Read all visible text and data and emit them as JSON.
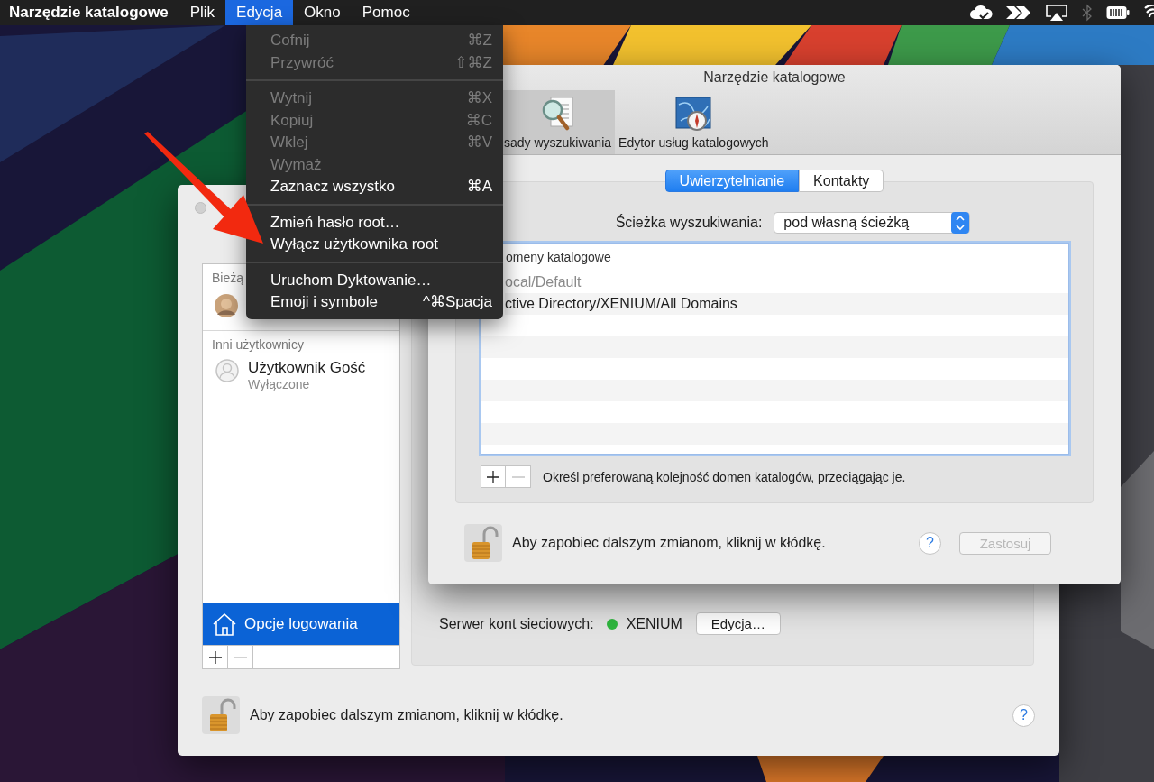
{
  "menu_bar": {
    "app_name": "Narzędzie katalogowe",
    "menus": [
      {
        "label": "Plik",
        "selected": false
      },
      {
        "label": "Edycja",
        "selected": true
      },
      {
        "label": "Okno",
        "selected": false
      },
      {
        "label": "Pomoc",
        "selected": false
      }
    ]
  },
  "edit_menu": {
    "groups": [
      {
        "items": [
          {
            "label": "Cofnij",
            "shortcut": "⌘Z",
            "disabled": true
          },
          {
            "label": "Przywróć",
            "shortcut": "⇧⌘Z",
            "disabled": true
          }
        ]
      },
      {
        "items": [
          {
            "label": "Wytnij",
            "shortcut": "⌘X",
            "disabled": true
          },
          {
            "label": "Kopiuj",
            "shortcut": "⌘C",
            "disabled": true
          },
          {
            "label": "Wklej",
            "shortcut": "⌘V",
            "disabled": true
          },
          {
            "label": "Wymaż",
            "disabled": true
          },
          {
            "label": "Zaznacz wszystko",
            "shortcut": "⌘A",
            "disabled": false
          }
        ]
      },
      {
        "items": [
          {
            "label": "Zmień hasło root…",
            "disabled": false
          },
          {
            "label": "Wyłącz użytkownika root",
            "disabled": false
          }
        ]
      },
      {
        "items": [
          {
            "label": "Uruchom Dyktowanie…",
            "disabled": false
          },
          {
            "label": "Emoji i symbole",
            "shortcut": "^⌘Spacja",
            "disabled": false
          }
        ]
      }
    ]
  },
  "back_window": {
    "current_users_header": "Bieżą",
    "other_users_header": "Inni użytkownicy",
    "users": [
      {
        "name": "Użytkownik Gość",
        "status": "Wyłączone"
      }
    ],
    "login_options": {
      "label": "Opcje logowania",
      "selected": true
    },
    "network_server": {
      "label": "Serwer kont sieciowych:",
      "connected": true,
      "name": "XENIUM",
      "button": "Edycja…"
    },
    "lock_text": "Aby zapobiec dalszym zmianom, kliknij w kłódkę.",
    "help_label": "?"
  },
  "front_window": {
    "title": "Narzędzie katalogowe",
    "toolbar": [
      {
        "label": "sady wyszukiwania",
        "selected": true,
        "kind": "search"
      },
      {
        "label": "Edytor usług katalogowych",
        "selected": false,
        "kind": "map"
      }
    ],
    "segments": [
      {
        "label": "Uwierzytelnianie",
        "selected": true
      },
      {
        "label": "Kontakty",
        "selected": false
      }
    ],
    "search_path": {
      "label": "Ścieżka wyszukiwania:",
      "value": "pod własną ścieżką"
    },
    "domains": {
      "header": "omeny katalogowe",
      "rows": [
        {
          "name": "ocal/Default",
          "disabled": true
        },
        {
          "name": "ctive Directory/XENIUM/All Domains",
          "disabled": false
        }
      ]
    },
    "hint": "Określ preferowaną kolejność domen katalogów, przeciągając je.",
    "lock_text": "Aby zapobiec dalszym zmianom, kliknij w kłódkę.",
    "help_label": "?",
    "apply": {
      "label": "Zastosuj",
      "disabled": true
    }
  }
}
